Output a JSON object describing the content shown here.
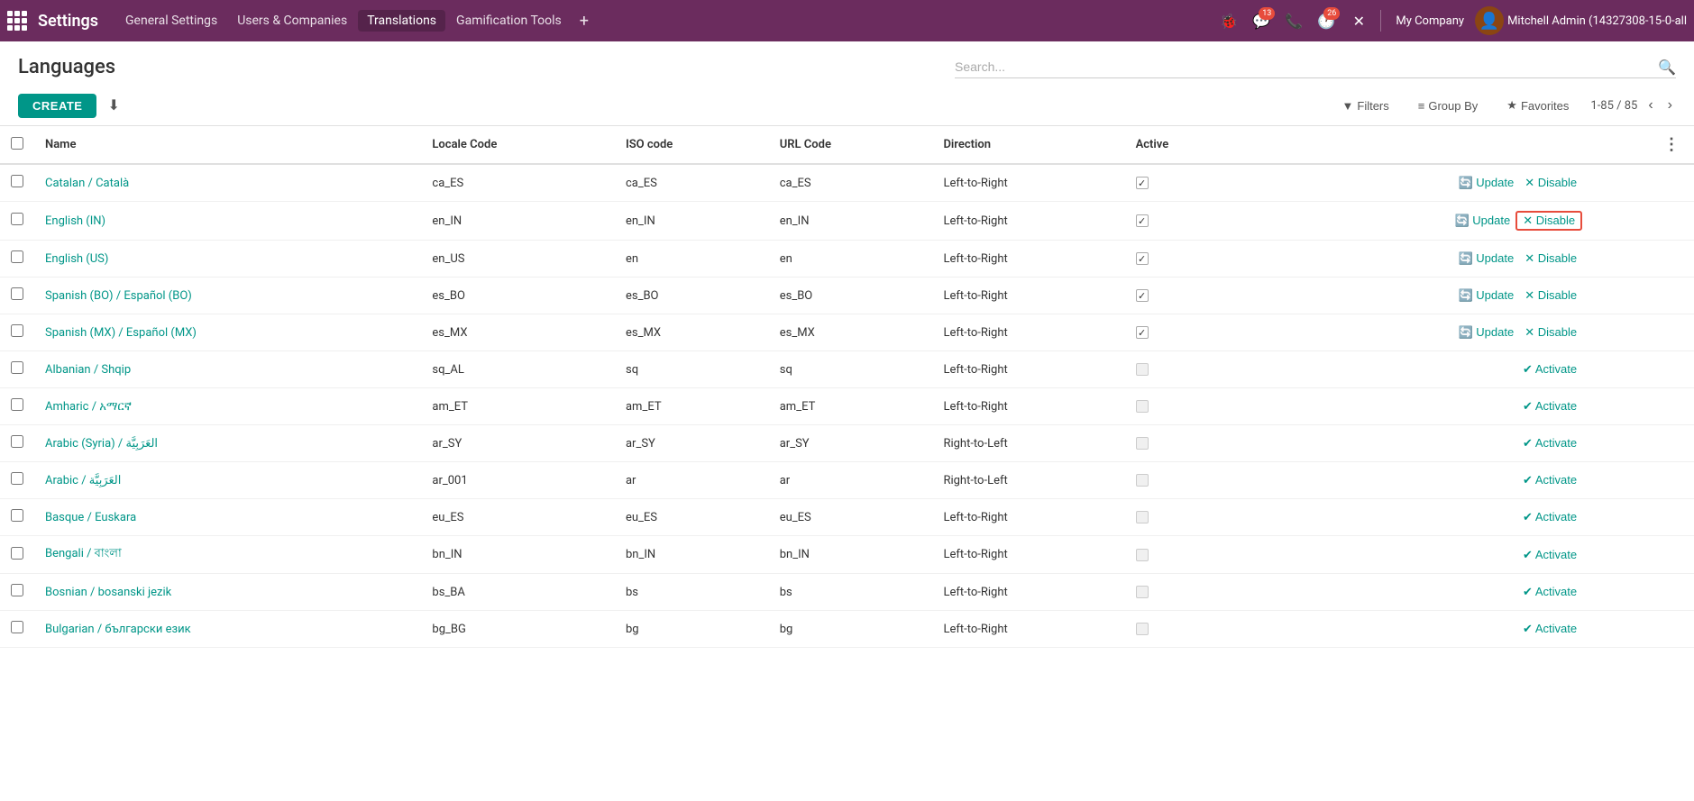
{
  "app": {
    "title": "Settings",
    "nav_items": [
      {
        "label": "General Settings",
        "active": false
      },
      {
        "label": "Users & Companies",
        "active": false
      },
      {
        "label": "Translations",
        "active": true
      },
      {
        "label": "Gamification Tools",
        "active": false
      }
    ]
  },
  "topbar": {
    "icons": [
      {
        "name": "bug-icon",
        "symbol": "🐞",
        "badge": null
      },
      {
        "name": "chat-icon",
        "symbol": "💬",
        "badge": "13"
      },
      {
        "name": "phone-icon",
        "symbol": "📞",
        "badge": null
      },
      {
        "name": "clock-icon",
        "symbol": "🕐",
        "badge": "26"
      },
      {
        "name": "close-icon",
        "symbol": "✕",
        "badge": null
      }
    ],
    "company": "My Company",
    "username": "Mitchell Admin (14327308-15-0-all"
  },
  "page": {
    "title": "Languages",
    "create_label": "CREATE",
    "search_placeholder": "Search...",
    "filters_label": "Filters",
    "groupby_label": "Group By",
    "favorites_label": "Favorites",
    "pagination": "1-85 / 85"
  },
  "table": {
    "columns": [
      "Name",
      "Locale Code",
      "ISO code",
      "URL Code",
      "Direction",
      "Active"
    ],
    "rows": [
      {
        "name": "Catalan / Català",
        "locale": "ca_ES",
        "iso": "ca_ES",
        "url": "ca_ES",
        "direction": "Left-to-Right",
        "active": true,
        "actions": [
          "Update",
          "Disable"
        ],
        "highlight_disable": false
      },
      {
        "name": "English (IN)",
        "locale": "en_IN",
        "iso": "en_IN",
        "url": "en_IN",
        "direction": "Left-to-Right",
        "active": true,
        "actions": [
          "Update",
          "Disable"
        ],
        "highlight_disable": true
      },
      {
        "name": "English (US)",
        "locale": "en_US",
        "iso": "en",
        "url": "en",
        "direction": "Left-to-Right",
        "active": true,
        "actions": [
          "Update",
          "Disable"
        ],
        "highlight_disable": false
      },
      {
        "name": "Spanish (BO) / Español (BO)",
        "locale": "es_BO",
        "iso": "es_BO",
        "url": "es_BO",
        "direction": "Left-to-Right",
        "active": true,
        "actions": [
          "Update",
          "Disable"
        ],
        "highlight_disable": false
      },
      {
        "name": "Spanish (MX) / Español (MX)",
        "locale": "es_MX",
        "iso": "es_MX",
        "url": "es_MX",
        "direction": "Left-to-Right",
        "active": true,
        "actions": [
          "Update",
          "Disable"
        ],
        "highlight_disable": false
      },
      {
        "name": "Albanian / Shqip",
        "locale": "sq_AL",
        "iso": "sq",
        "url": "sq",
        "direction": "Left-to-Right",
        "active": false,
        "actions": [
          "Activate"
        ],
        "highlight_disable": false
      },
      {
        "name": "Amharic / አማርኛ",
        "locale": "am_ET",
        "iso": "am_ET",
        "url": "am_ET",
        "direction": "Left-to-Right",
        "active": false,
        "actions": [
          "Activate"
        ],
        "highlight_disable": false
      },
      {
        "name": "Arabic (Syria) / العَرَبِيَّة",
        "locale": "ar_SY",
        "iso": "ar_SY",
        "url": "ar_SY",
        "direction": "Right-to-Left",
        "active": false,
        "actions": [
          "Activate"
        ],
        "highlight_disable": false
      },
      {
        "name": "Arabic / العَرَبِيَّة",
        "locale": "ar_001",
        "iso": "ar",
        "url": "ar",
        "direction": "Right-to-Left",
        "active": false,
        "actions": [
          "Activate"
        ],
        "highlight_disable": false
      },
      {
        "name": "Basque / Euskara",
        "locale": "eu_ES",
        "iso": "eu_ES",
        "url": "eu_ES",
        "direction": "Left-to-Right",
        "active": false,
        "actions": [
          "Activate"
        ],
        "highlight_disable": false
      },
      {
        "name": "Bengali / বাংলা",
        "locale": "bn_IN",
        "iso": "bn_IN",
        "url": "bn_IN",
        "direction": "Left-to-Right",
        "active": false,
        "actions": [
          "Activate"
        ],
        "highlight_disable": false
      },
      {
        "name": "Bosnian / bosanski jezik",
        "locale": "bs_BA",
        "iso": "bs",
        "url": "bs",
        "direction": "Left-to-Right",
        "active": false,
        "actions": [
          "Activate"
        ],
        "highlight_disable": false
      },
      {
        "name": "Bulgarian / български език",
        "locale": "bg_BG",
        "iso": "bg",
        "url": "bg",
        "direction": "Left-to-Right",
        "active": false,
        "actions": [
          "Activate"
        ],
        "highlight_disable": false
      }
    ]
  }
}
